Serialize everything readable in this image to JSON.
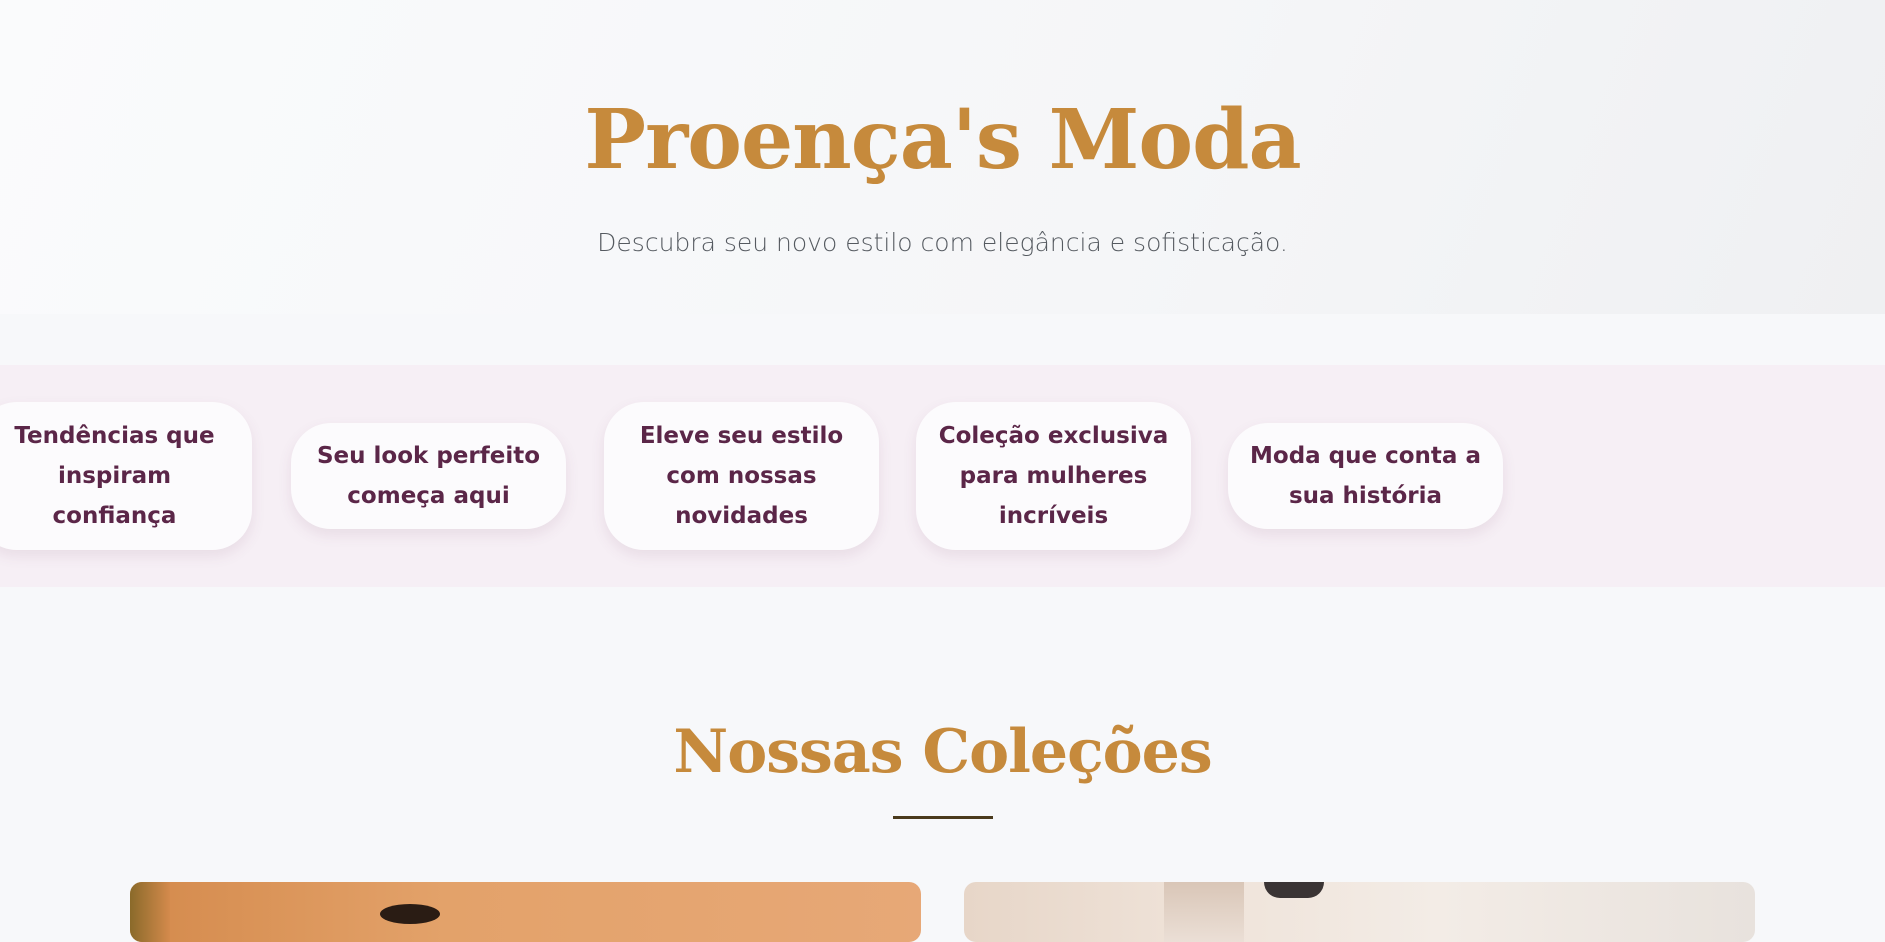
{
  "hero": {
    "title": "Proença's Moda",
    "subtitle": "Descubra seu novo estilo com elegância e sofisticação."
  },
  "marquee": {
    "items": [
      "Tendências que inspiram confiança",
      "Seu look perfeito começa aqui",
      "Eleve seu estilo com nossas novidades",
      "Coleção exclusiva para mulheres incríveis",
      "Moda que conta a sua história"
    ]
  },
  "collections": {
    "title": "Nossas Coleções"
  },
  "colors": {
    "brand_gold": "#c68a3c",
    "marquee_text": "#5b2648",
    "marquee_bg": "#f6eff5",
    "page_bg": "#f7f8fa"
  }
}
